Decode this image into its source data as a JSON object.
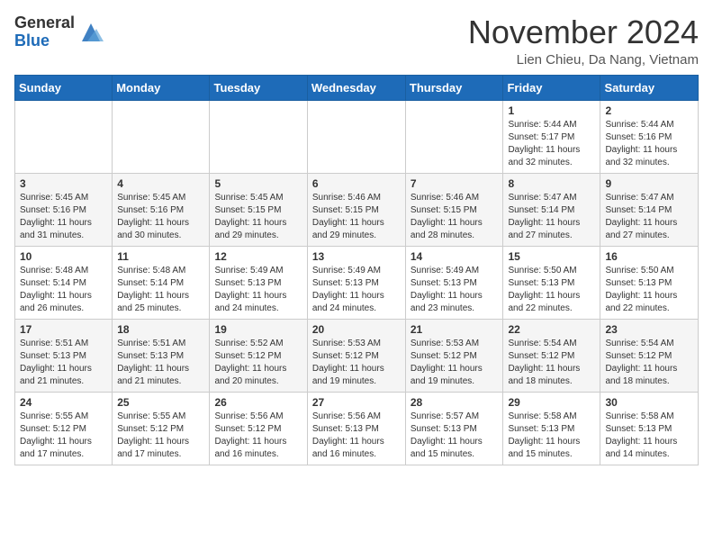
{
  "header": {
    "logo_general": "General",
    "logo_blue": "Blue",
    "month_title": "November 2024",
    "location": "Lien Chieu, Da Nang, Vietnam"
  },
  "weekdays": [
    "Sunday",
    "Monday",
    "Tuesday",
    "Wednesday",
    "Thursday",
    "Friday",
    "Saturday"
  ],
  "weeks": [
    [
      {
        "day": "",
        "info": ""
      },
      {
        "day": "",
        "info": ""
      },
      {
        "day": "",
        "info": ""
      },
      {
        "day": "",
        "info": ""
      },
      {
        "day": "",
        "info": ""
      },
      {
        "day": "1",
        "info": "Sunrise: 5:44 AM\nSunset: 5:17 PM\nDaylight: 11 hours and 32 minutes."
      },
      {
        "day": "2",
        "info": "Sunrise: 5:44 AM\nSunset: 5:16 PM\nDaylight: 11 hours and 32 minutes."
      }
    ],
    [
      {
        "day": "3",
        "info": "Sunrise: 5:45 AM\nSunset: 5:16 PM\nDaylight: 11 hours and 31 minutes."
      },
      {
        "day": "4",
        "info": "Sunrise: 5:45 AM\nSunset: 5:16 PM\nDaylight: 11 hours and 30 minutes."
      },
      {
        "day": "5",
        "info": "Sunrise: 5:45 AM\nSunset: 5:15 PM\nDaylight: 11 hours and 29 minutes."
      },
      {
        "day": "6",
        "info": "Sunrise: 5:46 AM\nSunset: 5:15 PM\nDaylight: 11 hours and 29 minutes."
      },
      {
        "day": "7",
        "info": "Sunrise: 5:46 AM\nSunset: 5:15 PM\nDaylight: 11 hours and 28 minutes."
      },
      {
        "day": "8",
        "info": "Sunrise: 5:47 AM\nSunset: 5:14 PM\nDaylight: 11 hours and 27 minutes."
      },
      {
        "day": "9",
        "info": "Sunrise: 5:47 AM\nSunset: 5:14 PM\nDaylight: 11 hours and 27 minutes."
      }
    ],
    [
      {
        "day": "10",
        "info": "Sunrise: 5:48 AM\nSunset: 5:14 PM\nDaylight: 11 hours and 26 minutes."
      },
      {
        "day": "11",
        "info": "Sunrise: 5:48 AM\nSunset: 5:14 PM\nDaylight: 11 hours and 25 minutes."
      },
      {
        "day": "12",
        "info": "Sunrise: 5:49 AM\nSunset: 5:13 PM\nDaylight: 11 hours and 24 minutes."
      },
      {
        "day": "13",
        "info": "Sunrise: 5:49 AM\nSunset: 5:13 PM\nDaylight: 11 hours and 24 minutes."
      },
      {
        "day": "14",
        "info": "Sunrise: 5:49 AM\nSunset: 5:13 PM\nDaylight: 11 hours and 23 minutes."
      },
      {
        "day": "15",
        "info": "Sunrise: 5:50 AM\nSunset: 5:13 PM\nDaylight: 11 hours and 22 minutes."
      },
      {
        "day": "16",
        "info": "Sunrise: 5:50 AM\nSunset: 5:13 PM\nDaylight: 11 hours and 22 minutes."
      }
    ],
    [
      {
        "day": "17",
        "info": "Sunrise: 5:51 AM\nSunset: 5:13 PM\nDaylight: 11 hours and 21 minutes."
      },
      {
        "day": "18",
        "info": "Sunrise: 5:51 AM\nSunset: 5:13 PM\nDaylight: 11 hours and 21 minutes."
      },
      {
        "day": "19",
        "info": "Sunrise: 5:52 AM\nSunset: 5:12 PM\nDaylight: 11 hours and 20 minutes."
      },
      {
        "day": "20",
        "info": "Sunrise: 5:53 AM\nSunset: 5:12 PM\nDaylight: 11 hours and 19 minutes."
      },
      {
        "day": "21",
        "info": "Sunrise: 5:53 AM\nSunset: 5:12 PM\nDaylight: 11 hours and 19 minutes."
      },
      {
        "day": "22",
        "info": "Sunrise: 5:54 AM\nSunset: 5:12 PM\nDaylight: 11 hours and 18 minutes."
      },
      {
        "day": "23",
        "info": "Sunrise: 5:54 AM\nSunset: 5:12 PM\nDaylight: 11 hours and 18 minutes."
      }
    ],
    [
      {
        "day": "24",
        "info": "Sunrise: 5:55 AM\nSunset: 5:12 PM\nDaylight: 11 hours and 17 minutes."
      },
      {
        "day": "25",
        "info": "Sunrise: 5:55 AM\nSunset: 5:12 PM\nDaylight: 11 hours and 17 minutes."
      },
      {
        "day": "26",
        "info": "Sunrise: 5:56 AM\nSunset: 5:12 PM\nDaylight: 11 hours and 16 minutes."
      },
      {
        "day": "27",
        "info": "Sunrise: 5:56 AM\nSunset: 5:13 PM\nDaylight: 11 hours and 16 minutes."
      },
      {
        "day": "28",
        "info": "Sunrise: 5:57 AM\nSunset: 5:13 PM\nDaylight: 11 hours and 15 minutes."
      },
      {
        "day": "29",
        "info": "Sunrise: 5:58 AM\nSunset: 5:13 PM\nDaylight: 11 hours and 15 minutes."
      },
      {
        "day": "30",
        "info": "Sunrise: 5:58 AM\nSunset: 5:13 PM\nDaylight: 11 hours and 14 minutes."
      }
    ]
  ]
}
